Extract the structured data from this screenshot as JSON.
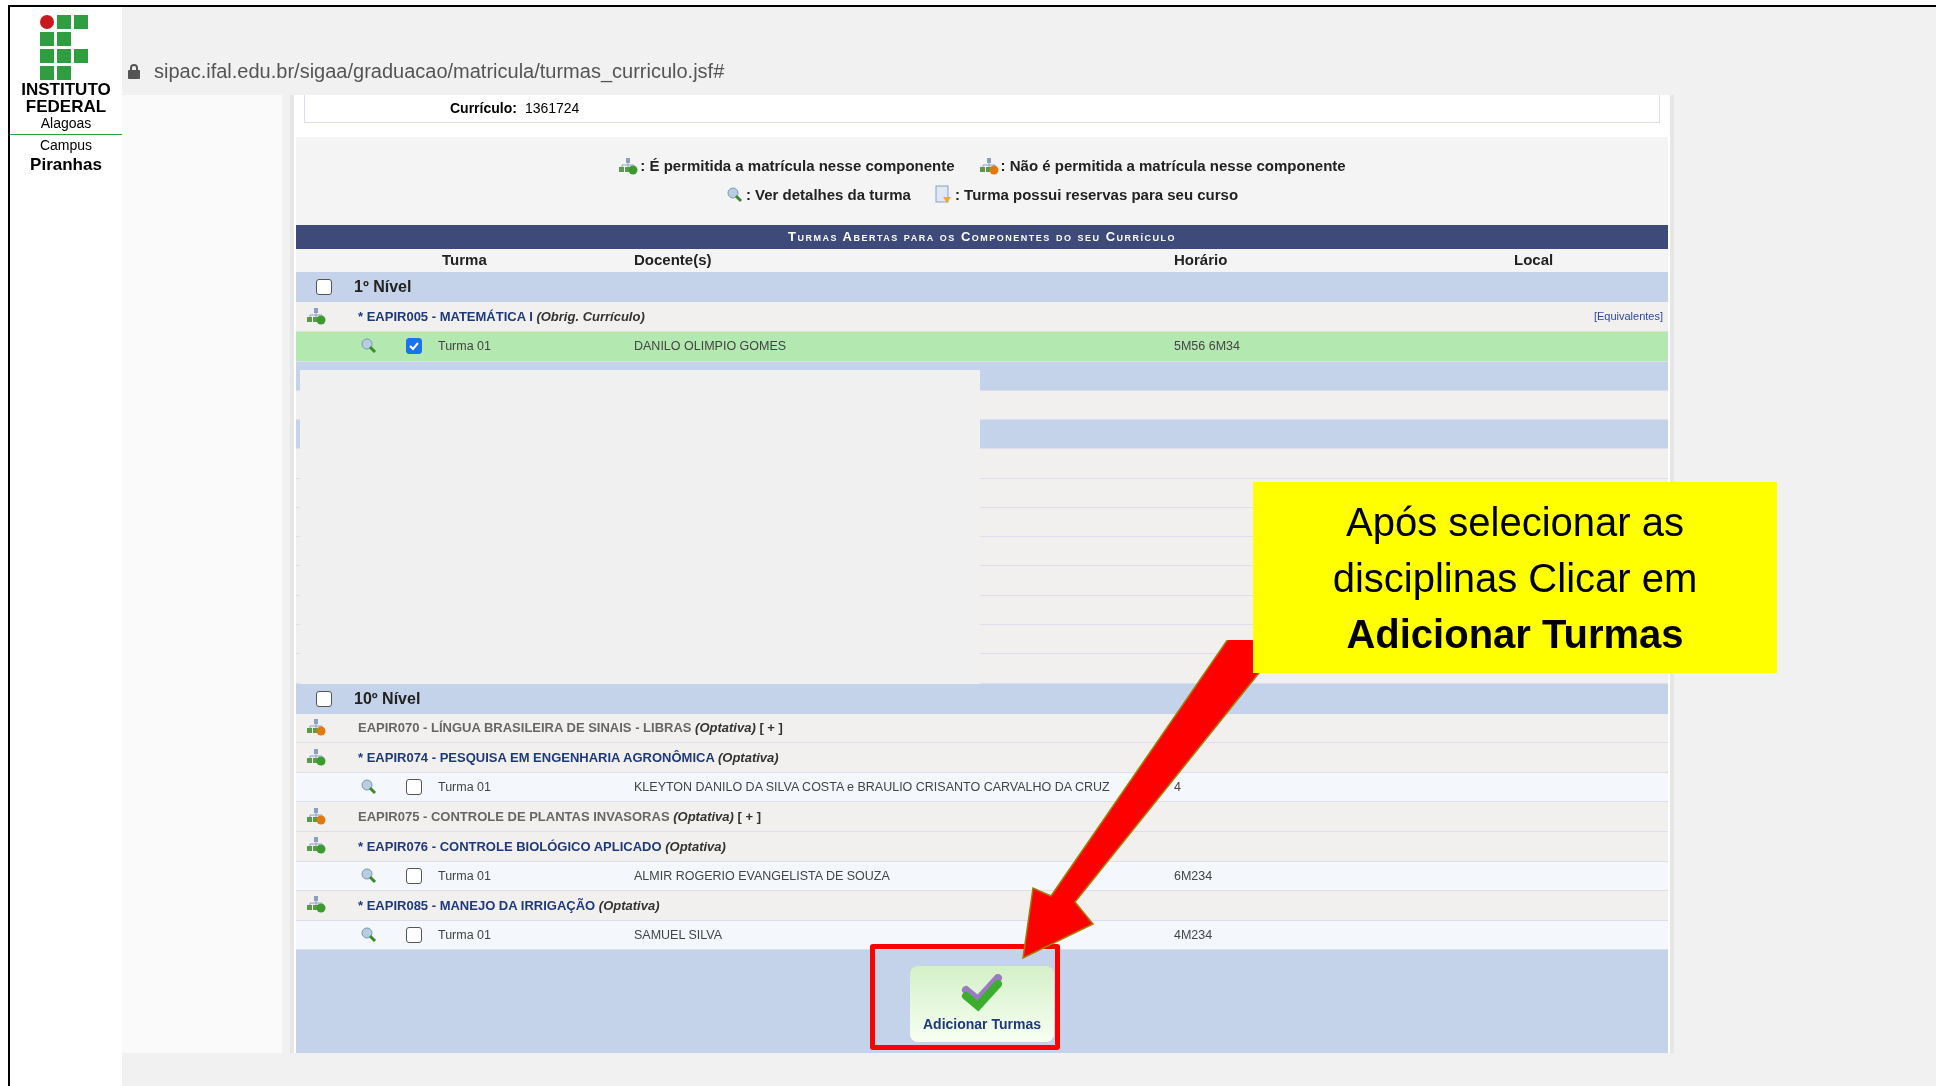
{
  "logo": {
    "name_lines": [
      "INSTITUTO",
      "FEDERAL"
    ],
    "state": "Alagoas",
    "campus_label": "Campus",
    "campus": "Piranhas"
  },
  "browser": {
    "url": "sipac.ifal.edu.br/sigaa/graduacao/matricula/turmas_curriculo.jsf#"
  },
  "curriculo": {
    "label": "Currículo:",
    "value": "1361724"
  },
  "legend": [
    [
      {
        "kind": "allowed",
        "text": ": É permitida a matrícula nesse componente"
      },
      {
        "kind": "denied",
        "text": ": Não é permitida a matrícula nesse componente"
      }
    ],
    [
      {
        "kind": "details",
        "text": ": Ver detalhes da turma"
      },
      {
        "kind": "reserve",
        "text": ": Turma possui reservas para seu curso"
      }
    ]
  ],
  "table": {
    "title": "Turmas Abertas para os Componentes do seu Currículo",
    "columns": [
      "Turma",
      "Docente(s)",
      "Horário",
      "Local"
    ],
    "levels": [
      {
        "label": "1º Nível",
        "checked": false,
        "rows": [
          {
            "kind": "component",
            "allowed": true,
            "name": "* EAPIR005 - MATEMÁTICA I",
            "tag": "(Obrig. Currículo)",
            "link": "[Equivalentes]"
          },
          {
            "kind": "turma",
            "checked": true,
            "turma": "Turma 01",
            "docente": "DANILO OLIMPIO GOMES",
            "horario": "5M56 6M34"
          },
          {
            "kind": "blank"
          }
        ]
      },
      {
        "label": "10º Nível",
        "checked": false,
        "rows": [
          {
            "kind": "component",
            "allowed": false,
            "name": "EAPIR070 - LÍNGUA BRASILEIRA DE SINAIS - LIBRAS",
            "tag": "(Optativa)",
            "expand": "[ + ]"
          },
          {
            "kind": "component",
            "allowed": true,
            "name": "* EAPIR074 - PESQUISA EM ENGENHARIA AGRONÔMICA",
            "tag": "(Optativa)"
          },
          {
            "kind": "turma",
            "checked": false,
            "turma": "Turma 01",
            "docente": "KLEYTON DANILO DA SILVA COSTA e BRAULIO CRISANTO CARVALHO DA CRUZ",
            "horario": "4"
          },
          {
            "kind": "component",
            "allowed": false,
            "name": "EAPIR075 - CONTROLE DE PLANTAS INVASORAS",
            "tag": "(Optativa)",
            "expand": "[ + ]"
          },
          {
            "kind": "component",
            "allowed": true,
            "name": "* EAPIR076 - CONTROLE BIOLÓGICO APLICADO",
            "tag": "(Optativa)"
          },
          {
            "kind": "turma",
            "checked": false,
            "turma": "Turma 01",
            "docente": "ALMIR ROGERIO EVANGELISTA DE SOUZA",
            "horario": "6M234"
          },
          {
            "kind": "component",
            "allowed": true,
            "name": "* EAPIR085 - MANEJO DA IRRIGAÇÃO",
            "tag": "(Optativa)"
          },
          {
            "kind": "turma",
            "checked": false,
            "turma": "Turma 01",
            "docente": "SAMUEL SILVA",
            "horario": "4M234"
          }
        ]
      }
    ],
    "button": "Adicionar Turmas"
  },
  "callout": {
    "text": "Após selecionar as disciplinas Clicar em **Adicionar Turmas**"
  }
}
